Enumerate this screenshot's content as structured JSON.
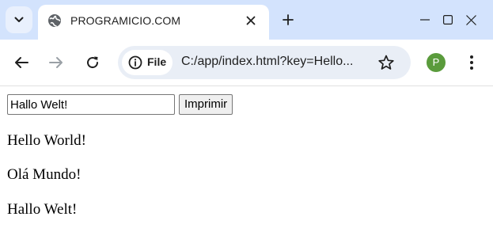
{
  "browser": {
    "tab": {
      "title": "PROGRAMICIO.COM"
    },
    "site_chip_label": "File",
    "url": "C:/app/index.html?key=Hello...",
    "avatar_letter": "P",
    "colors": {
      "tabstrip": "#d3e3fd",
      "omnibox": "#e9eef6",
      "avatar": "#5a9b3c"
    },
    "icons": [
      "tab-search-icon",
      "globe-icon",
      "close-icon",
      "plus-icon",
      "minimize-icon",
      "maximize-icon",
      "window-close-icon",
      "back-arrow-icon",
      "forward-arrow-icon",
      "reload-icon",
      "info-icon",
      "star-icon",
      "kebab-menu-icon"
    ]
  },
  "page": {
    "input_value": "Hallo Welt!",
    "button_label": "Imprimir",
    "lines": [
      "Hello World!",
      "Olá Mundo!",
      "Hallo Welt!"
    ]
  }
}
